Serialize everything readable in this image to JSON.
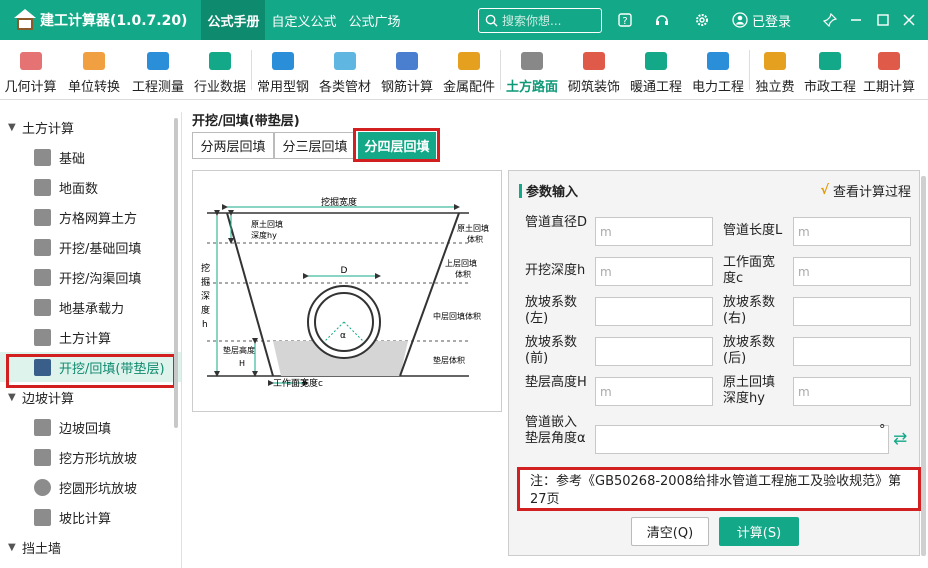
{
  "app": {
    "title": "建工计算器(1.0.7.20)",
    "nav_tabs": [
      {
        "label": "公式手册",
        "active": true
      },
      {
        "label": "自定义公式",
        "active": false
      },
      {
        "label": "公式广场",
        "active": false
      }
    ],
    "search_placeholder": "搜索你想...",
    "login_label": "已登录",
    "accent_color": "#13a887"
  },
  "toolbar": [
    {
      "label": "几何计算",
      "icon": "cube-icon",
      "color": "#e57373"
    },
    {
      "label": "单位转换",
      "icon": "unit-cm-icon",
      "color": "#f0a040"
    },
    {
      "label": "工程测量",
      "icon": "ruler-axis-icon",
      "color": "#2a8fd8"
    },
    {
      "label": "行业数据",
      "icon": "bar-chart-icon",
      "color": "#13a887"
    },
    {
      "label": "常用型钢",
      "icon": "wrench-icon",
      "color": "#2a8fd8"
    },
    {
      "label": "各类管材",
      "icon": "pipe-icon",
      "color": "#5fb6e0"
    },
    {
      "label": "钢筋计算",
      "icon": "rebar-icon",
      "color": "#4a7fd0"
    },
    {
      "label": "金属配件",
      "icon": "hardware-icon",
      "color": "#e6a020"
    },
    {
      "label": "土方路面",
      "icon": "road-icon",
      "color": "#888888",
      "active": true
    },
    {
      "label": "砌筑装饰",
      "icon": "brick-wall-icon",
      "color": "#e05a4a"
    },
    {
      "label": "暖通工程",
      "icon": "fan-icon",
      "color": "#13a887"
    },
    {
      "label": "电力工程",
      "icon": "house-power-icon",
      "color": "#2a8fd8"
    },
    {
      "label": "独立费",
      "icon": "price-chart-icon",
      "color": "#e6a020"
    },
    {
      "label": "市政工程",
      "icon": "city-icon",
      "color": "#13a887"
    },
    {
      "label": "工期计算",
      "icon": "calendar-icon",
      "color": "#e05a4a"
    }
  ],
  "sidebar": {
    "categories": [
      {
        "label": "土方计算",
        "items": [
          {
            "label": "基础",
            "icon": "foundation-icon"
          },
          {
            "label": "地面数",
            "icon": "ground-grid-icon"
          },
          {
            "label": "方格网算土方",
            "icon": "grid-icon"
          },
          {
            "label": "开挖/基础回填",
            "icon": "excavation-icon"
          },
          {
            "label": "开挖/沟渠回填",
            "icon": "trench-icon"
          },
          {
            "label": "地基承载力",
            "icon": "bearing-vip-icon"
          },
          {
            "label": "土方计算",
            "icon": "earthwork-icon"
          },
          {
            "label": "开挖/回填(带垫层)",
            "icon": "excavation-cushion-icon",
            "active": true
          }
        ]
      },
      {
        "label": "边坡计算",
        "items": [
          {
            "label": "边坡回填",
            "icon": "slope-fill-icon"
          },
          {
            "label": "挖方形坑放坡",
            "icon": "square-pit-icon"
          },
          {
            "label": "挖圆形坑放坡",
            "icon": "round-pit-icon"
          },
          {
            "label": "坡比计算",
            "icon": "slope-ratio-icon"
          }
        ]
      },
      {
        "label": "挡土墙",
        "items": []
      }
    ]
  },
  "main": {
    "title": "开挖/回填(带垫层)",
    "segments": [
      {
        "label": "分两层回填",
        "active": false
      },
      {
        "label": "分三层回填",
        "active": false
      },
      {
        "label": "分四层回填",
        "active": true
      }
    ],
    "diagram": {
      "width_label": "挖掘宽度",
      "orig_soil_depth_label_1": "原土回填",
      "orig_soil_depth_label_2": "深度hy",
      "orig_soil_vol_label_1": "原土回填",
      "orig_soil_vol_label_2": "体积",
      "dig_depth_chars": [
        "挖",
        "掘",
        "深",
        "度",
        "h"
      ],
      "diameter_label": "D",
      "upper_fill_label_1": "上层回填",
      "upper_fill_label_2": "体积",
      "middle_fill_label": "中层回填体积",
      "alpha_label": "α",
      "cushion_height_label_1": "垫层高度",
      "cushion_height_label_2": "H",
      "cushion_vol_label": "垫层体积",
      "work_width_label": "工作面宽度c"
    },
    "panel": {
      "heading": "参数输入",
      "view_calc_label": "查看计算过程",
      "fields": [
        {
          "label": "管道直径D",
          "placeholder": "m"
        },
        {
          "label": "管道长度L",
          "placeholder": "m"
        },
        {
          "label": "开挖深度h",
          "placeholder": "m"
        },
        {
          "label": "工作面宽度c",
          "placeholder": "m"
        },
        {
          "label": "放坡系数(左)",
          "placeholder": ""
        },
        {
          "label": "放坡系数(右)",
          "placeholder": ""
        },
        {
          "label": "放坡系数(前)",
          "placeholder": ""
        },
        {
          "label": "放坡系数(后)",
          "placeholder": ""
        },
        {
          "label": "垫层高度H",
          "placeholder": "m"
        },
        {
          "label": "原土回填深度hy",
          "placeholder": "m"
        }
      ],
      "angle_label": "管道嵌入垫层角度α",
      "degree_symbol": "°",
      "note": "注：参考《GB50268-2008给排水管道工程施工及验收规范》第27页",
      "clear_label": "清空(Q)",
      "calc_label": "计算(S)"
    }
  }
}
